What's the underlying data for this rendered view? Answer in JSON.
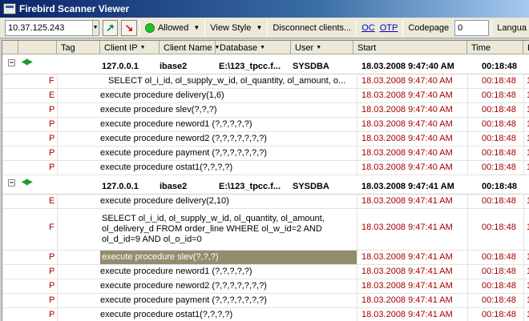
{
  "window": {
    "title": "Firebird Scanner Viewer"
  },
  "toolbar": {
    "host": "10.37.125.243",
    "allowed_label": "Allowed",
    "view_style_label": "View Style",
    "disconnect_label": "Disconnect clients...",
    "oc_label": "OC",
    "otp_label": "OTP",
    "codepage_label": "Codepage",
    "codepage_value": "0",
    "language_label": "Langua"
  },
  "columns": [
    "Tag",
    "Client IP",
    "Client Name",
    "Database",
    "User",
    "Start",
    "Time"
  ],
  "groups": [
    {
      "client_ip": "127.0.0.1",
      "client_name": "ibase2",
      "database": "E:\\123_tpcc.f...",
      "user": "SYSDBA",
      "start": "18.03.2008 9:47:40 AM",
      "time": "00:18:48",
      "rows": [
        {
          "tag": "F",
          "text": "SELECT ol_i_id, ol_supply_w_id, ol_quantity,    ol_amount, o...",
          "start": "18.03.2008 9:47:40 AM",
          "time": "00:18:48",
          "extra": "1"
        },
        {
          "tag": "E",
          "text": "execute procedure delivery(1,6)",
          "start": "18.03.2008 9:47:40 AM",
          "time": "00:18:48",
          "extra": "1"
        },
        {
          "tag": "P",
          "text": "execute procedure slev(?,?,?)",
          "start": "18.03.2008 9:47:40 AM",
          "time": "00:18:48",
          "extra": "1"
        },
        {
          "tag": "P",
          "text": "execute procedure neword1 (?,?,?,?,?)",
          "start": "18.03.2008 9:47:40 AM",
          "time": "00:18:48",
          "extra": "1"
        },
        {
          "tag": "P",
          "text": "execute procedure neword2 (?,?,?,?,?,?,?)",
          "start": "18.03.2008 9:47:40 AM",
          "time": "00:18:48",
          "extra": "1"
        },
        {
          "tag": "P",
          "text": "execute procedure payment (?,?,?,?,?,?,?)",
          "start": "18.03.2008 9:47:40 AM",
          "time": "00:18:48",
          "extra": "1"
        },
        {
          "tag": "P",
          "text": "execute procedure ostat1(?,?,?,?)",
          "start": "18.03.2008 9:47:40 AM",
          "time": "00:18:48",
          "extra": "1"
        }
      ]
    },
    {
      "client_ip": "127.0.0.1",
      "client_name": "ibase2",
      "database": "E:\\123_tpcc.f...",
      "user": "SYSDBA",
      "start": "18.03.2008 9:47:41 AM",
      "time": "00:18:48",
      "rows": [
        {
          "tag": "E",
          "text": "execute procedure delivery(2,10)",
          "start": "18.03.2008 9:47:41 AM",
          "time": "00:18:48",
          "extra": "1"
        },
        {
          "tag": "F",
          "text": "SELECT ol_i_id, ol_supply_w_id, ol_quantity,    ol_amount, ol_delivery_d    FROM order_line    WHERE ol_w_id=2 AND ol_d_id=9 AND ol_o_id=0",
          "start": "18.03.2008 9:47:41 AM",
          "time": "00:18:48",
          "extra": "1"
        },
        {
          "tag": "P",
          "text": "execute procedure slev(?,?,?)",
          "start": "18.03.2008 9:47:41 AM",
          "time": "00:18:48",
          "extra": "1",
          "selected": true
        },
        {
          "tag": "P",
          "text": "execute procedure neword1 (?,?,?,?,?)",
          "start": "18.03.2008 9:47:41 AM",
          "time": "00:18:48",
          "extra": "1"
        },
        {
          "tag": "P",
          "text": "execute procedure neword2 (?,?,?,?,?,?,?)",
          "start": "18.03.2008 9:47:41 AM",
          "time": "00:18:48",
          "extra": "1"
        },
        {
          "tag": "P",
          "text": "execute procedure payment (?,?,?,?,?,?,?)",
          "start": "18.03.2008 9:47:41 AM",
          "time": "00:18:48",
          "extra": "1"
        },
        {
          "tag": "P",
          "text": "execute procedure ostat1(?,?,?,?)",
          "start": "18.03.2008 9:47:41 AM",
          "time": "00:18:48",
          "extra": "1"
        }
      ]
    }
  ]
}
